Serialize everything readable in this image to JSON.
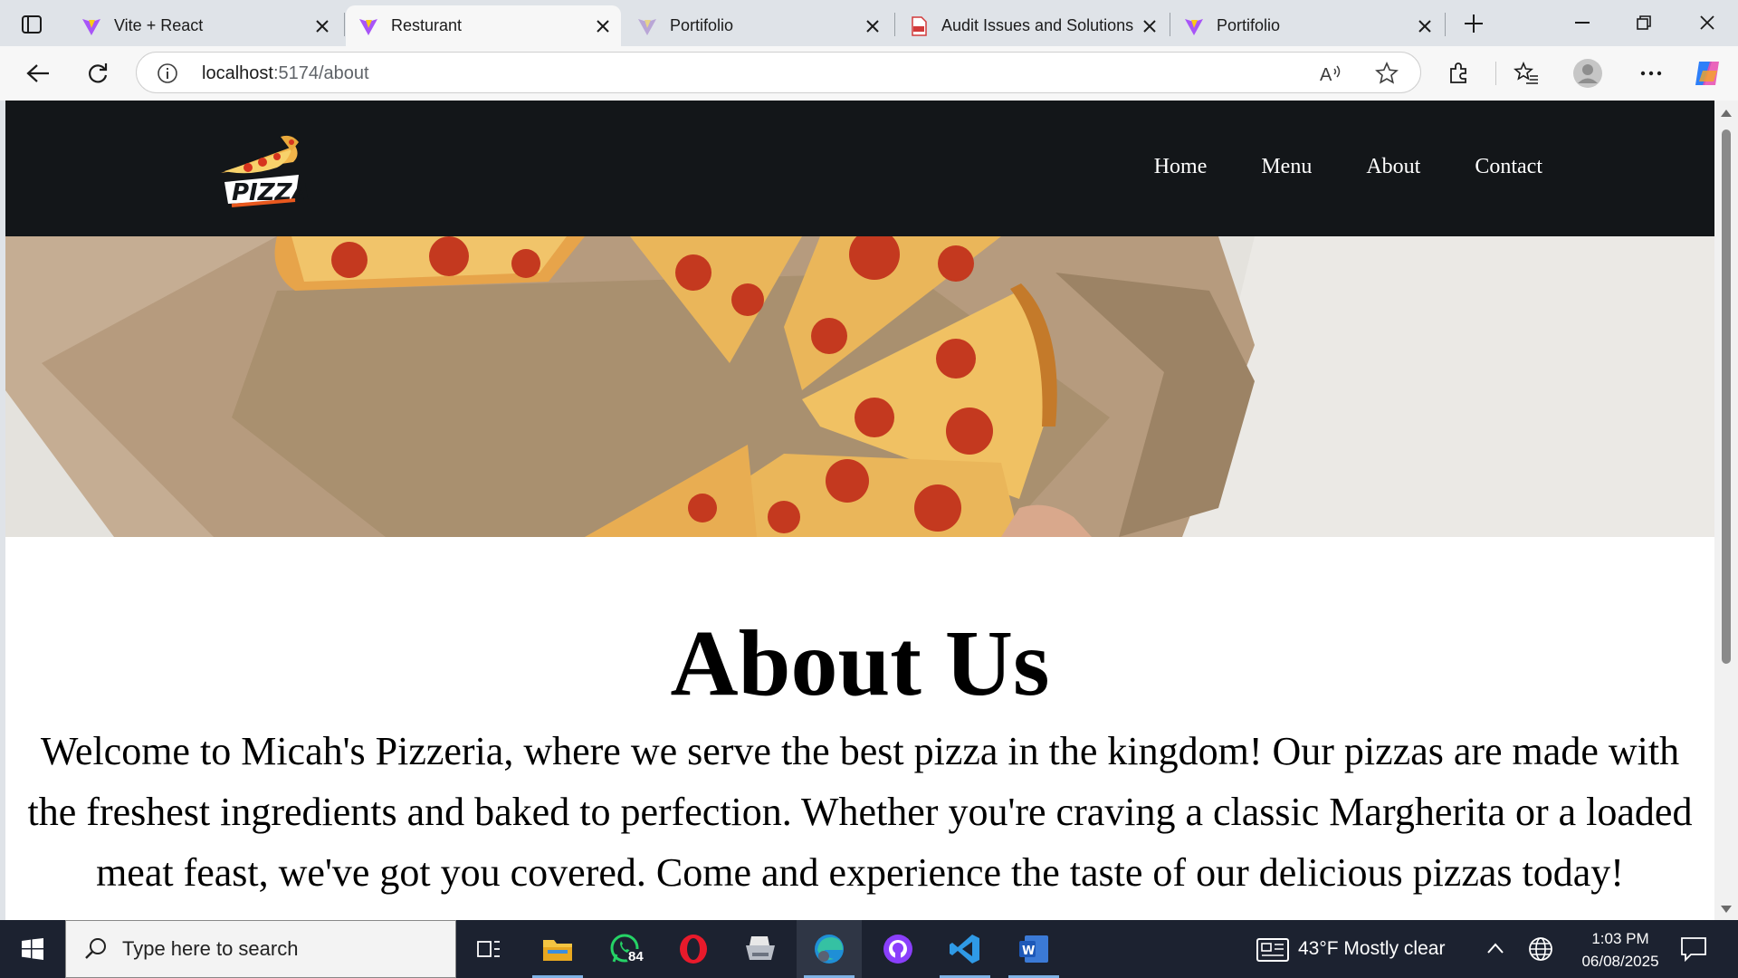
{
  "browser": {
    "tabs": [
      {
        "title": "Vite + React",
        "icon": "vite-icon",
        "active": false
      },
      {
        "title": "Resturant",
        "icon": "vite-icon",
        "active": true
      },
      {
        "title": "Portifolio",
        "icon": "vite-icon",
        "active": false
      },
      {
        "title": "Audit Issues and Solutions",
        "icon": "pdf-icon",
        "active": false
      },
      {
        "title": "Portifolio",
        "icon": "vite-icon",
        "active": false
      }
    ],
    "url": {
      "host": "localhost",
      "path": ":5174/about"
    }
  },
  "site": {
    "logo_text": "PIZZA",
    "nav": [
      "Home",
      "Menu",
      "About",
      "Contact"
    ],
    "about": {
      "heading": "About Us",
      "lines": [
        "Welcome to Micah's Pizzeria, where we serve the best pizza in the kingdom! Our pizzas are made with",
        "the freshest ingredients and baked to perfection. Whether you're craving a classic Margherita or a loaded",
        "meat feast, we've got you covered. Come and experience the taste of our delicious pizzas today!"
      ]
    }
  },
  "taskbar": {
    "search_placeholder": "Type here to search",
    "whatsapp_badge": "84",
    "weather": "43°F  Mostly clear",
    "time": "1:03 PM",
    "date": "06/08/2025"
  },
  "colors": {
    "header_bg": "#131619",
    "page_bg": "#ffffff",
    "taskbar_bg": "#1c2230",
    "chrome_bg": "#dfe3e8"
  }
}
